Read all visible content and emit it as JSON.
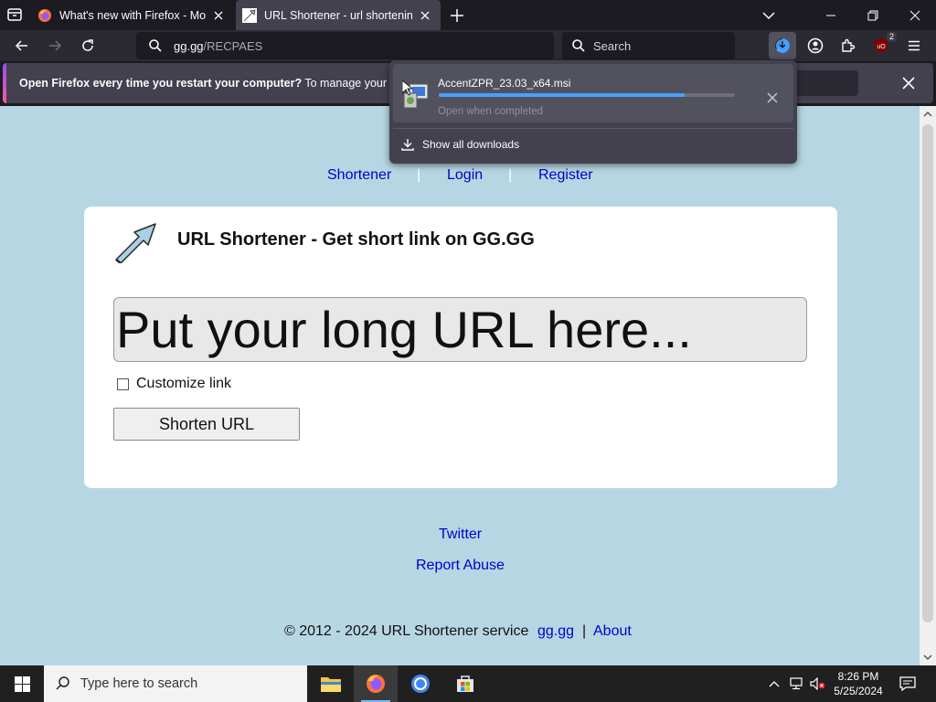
{
  "browser": {
    "tabs": [
      {
        "title": "What's new with Firefox - More",
        "active": false
      },
      {
        "title": "URL Shortener - url shortening s",
        "active": true
      }
    ],
    "url": {
      "host": "gg.gg",
      "path": "/RECPAES"
    },
    "search_placeholder": "Search",
    "extension_badge": "2",
    "notification": {
      "bold": "Open Firefox every time you restart your computer?",
      "text": " To manage your Start"
    }
  },
  "downloads_panel": {
    "filename": "AccentZPR_23.03_x64.msi",
    "status": "Open when completed",
    "progress": 0.83,
    "show_all": "Show all downloads"
  },
  "page": {
    "nav": {
      "shortener": "Shortener",
      "login": "Login",
      "register": "Register",
      "sep": "|"
    },
    "heading": "URL Shortener - Get short link on GG.GG",
    "url_input_placeholder": "Put your long URL here...",
    "customize_label": "Customize link",
    "shorten_button": "Shorten URL",
    "footer": {
      "twitter": "Twitter",
      "report": "Report Abuse",
      "copyright": "© 2012 - 2024 URL Shortener service",
      "gg_link": "gg.gg",
      "sep": "|",
      "about": "About"
    }
  },
  "taskbar": {
    "search_placeholder": "Type here to search",
    "time": "8:26 PM",
    "date": "5/25/2024"
  },
  "colors": {
    "page_bg": "#b7d6e3",
    "link": "#0000cc",
    "progress": "#45a1ff"
  }
}
